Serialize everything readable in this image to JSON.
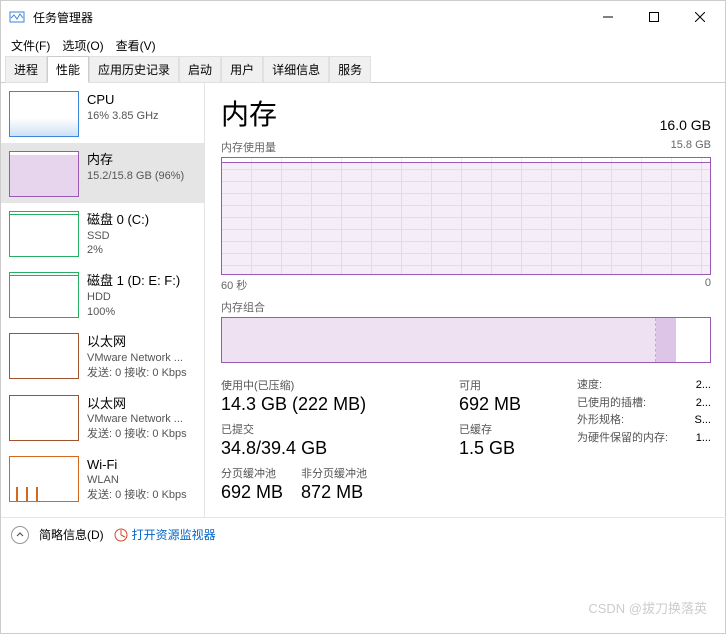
{
  "window": {
    "title": "任务管理器"
  },
  "menu": {
    "file": "文件(F)",
    "options": "选项(O)",
    "view": "查看(V)"
  },
  "tabs": [
    "进程",
    "性能",
    "应用历史记录",
    "启动",
    "用户",
    "详细信息",
    "服务"
  ],
  "sidebar": [
    {
      "title": "CPU",
      "line2": "16%  3.85 GHz",
      "line3": ""
    },
    {
      "title": "内存",
      "line2": "15.2/15.8 GB (96%)",
      "line3": ""
    },
    {
      "title": "磁盘 0 (C:)",
      "line2": "SSD",
      "line3": "2%"
    },
    {
      "title": "磁盘 1 (D: E: F:)",
      "line2": "HDD",
      "line3": "100%"
    },
    {
      "title": "以太网",
      "line2": "VMware Network ...",
      "line3": "发送: 0 接收: 0 Kbps"
    },
    {
      "title": "以太网",
      "line2": "VMware Network ...",
      "line3": "发送: 0 接收: 0 Kbps"
    },
    {
      "title": "Wi-Fi",
      "line2": "WLAN",
      "line3": "发送: 0 接收: 0 Kbps"
    }
  ],
  "main": {
    "title": "内存",
    "capacity": "16.0 GB",
    "usage_label": "内存使用量",
    "usage_max": "15.8 GB",
    "axis_left": "60 秒",
    "axis_right": "0",
    "comp_label": "内存组合",
    "stats": {
      "in_use_label": "使用中(已压缩)",
      "in_use_value": "14.3 GB (222 MB)",
      "available_label": "可用",
      "available_value": "692 MB",
      "committed_label": "已提交",
      "committed_value": "34.8/39.4 GB",
      "cached_label": "已缓存",
      "cached_value": "1.5 GB",
      "paged_label": "分页缓冲池",
      "paged_value": "692 MB",
      "nonpaged_label": "非分页缓冲池",
      "nonpaged_value": "872 MB"
    },
    "info": {
      "speed_k": "速度:",
      "speed_v": "2...",
      "slots_k": "已使用的插槽:",
      "slots_v": "2...",
      "form_k": "外形规格:",
      "form_v": "S...",
      "hw_k": "为硬件保留的内存:",
      "hw_v": "1..."
    }
  },
  "footer": {
    "brief": "简略信息(D)",
    "resmon": "打开资源监视器"
  },
  "watermark": "CSDN @拔刀换落英",
  "chart_data": {
    "type": "area",
    "title": "内存使用量",
    "ylabel": "GB",
    "ylim": [
      0,
      15.8
    ],
    "xrange_seconds": 60,
    "series": [
      {
        "name": "Memory in use",
        "approx_constant_value_gb": 15.2
      }
    ],
    "composition_bar": {
      "total_gb": 16.0,
      "segments": [
        {
          "name": "使用中",
          "gb": 14.3
        },
        {
          "name": "已修改/待机",
          "gb": 0.8
        },
        {
          "name": "可用",
          "gb": 0.7
        }
      ]
    }
  }
}
